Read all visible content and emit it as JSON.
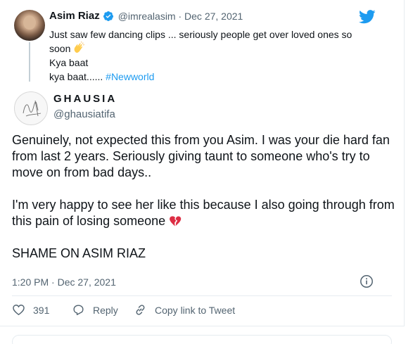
{
  "quoted_tweet": {
    "author_name": "Asim Riaz",
    "handle_date": "@imrealasim · Dec 27, 2021",
    "line1": "Just saw few dancing clips ... seriously people get over loved ones so",
    "line2": "soon",
    "line3": "Kya baat",
    "line4_prefix": "kya baat...... ",
    "hashtag": "#Newworld",
    "verified_icon": "verified-badge-icon",
    "emoji_icon": "clapping-hands-icon",
    "platform_icon": "twitter-bird-icon",
    "colors": {
      "link": "#1d9bf0",
      "verified": "#1d9bf0"
    }
  },
  "main_tweet": {
    "author_name": "GHAUSIA",
    "handle": "@ghausiatifa",
    "para1": "Genuinely, not expected this from you Asim. I was your die hard fan from last 2 years. Seriously giving taunt to someone who's try to move on from bad days..",
    "para2": "I'm very happy to see her like this because I also going through from this pain of losing someone",
    "para3": "SHAME ON ASIM RIAZ",
    "emoji_icon": "broken-heart-icon",
    "timestamp": "1:20 PM · Dec 27, 2021",
    "info_icon": "info-icon"
  },
  "actions": {
    "likes_count": "391",
    "reply_label": "Reply",
    "copy_link_label": "Copy link to Tweet"
  }
}
